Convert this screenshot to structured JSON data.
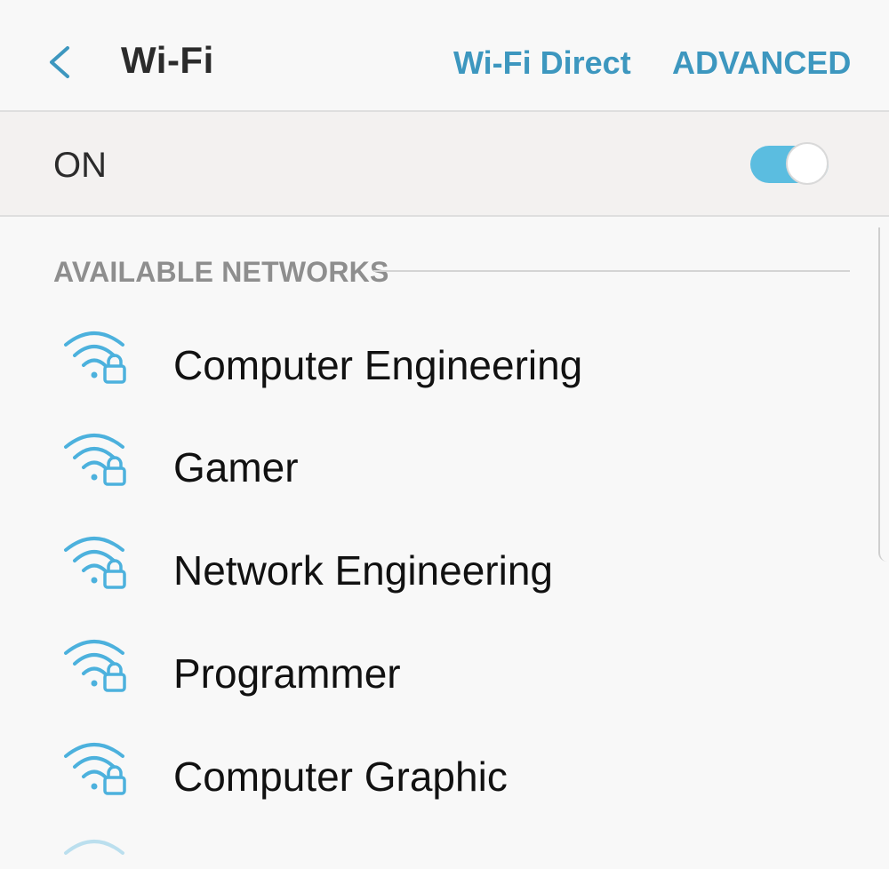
{
  "header": {
    "title": "Wi-Fi",
    "back_icon": "chevron-left-icon",
    "wifi_direct_label": "Wi-Fi Direct",
    "advanced_label": "ADVANCED"
  },
  "wifi_toggle": {
    "label": "ON",
    "state": "on"
  },
  "networks_section": {
    "label": "AVAILABLE NETWORKS",
    "items": [
      {
        "name": "Computer Engineering",
        "icon": "wifi-lock-icon",
        "secured": true
      },
      {
        "name": "Gamer",
        "icon": "wifi-lock-icon",
        "secured": true
      },
      {
        "name": "Network Engineering",
        "icon": "wifi-lock-icon",
        "secured": true
      },
      {
        "name": "Programmer",
        "icon": "wifi-lock-icon",
        "secured": true
      },
      {
        "name": "Computer Graphic",
        "icon": "wifi-lock-icon",
        "secured": true
      }
    ]
  },
  "colors": {
    "accent": "#3d97bf",
    "switch_on": "#5bbde0",
    "wifi_icon": "#4cb1dd",
    "section_label": "#8e8e8e",
    "background": "#f8f8f8"
  }
}
